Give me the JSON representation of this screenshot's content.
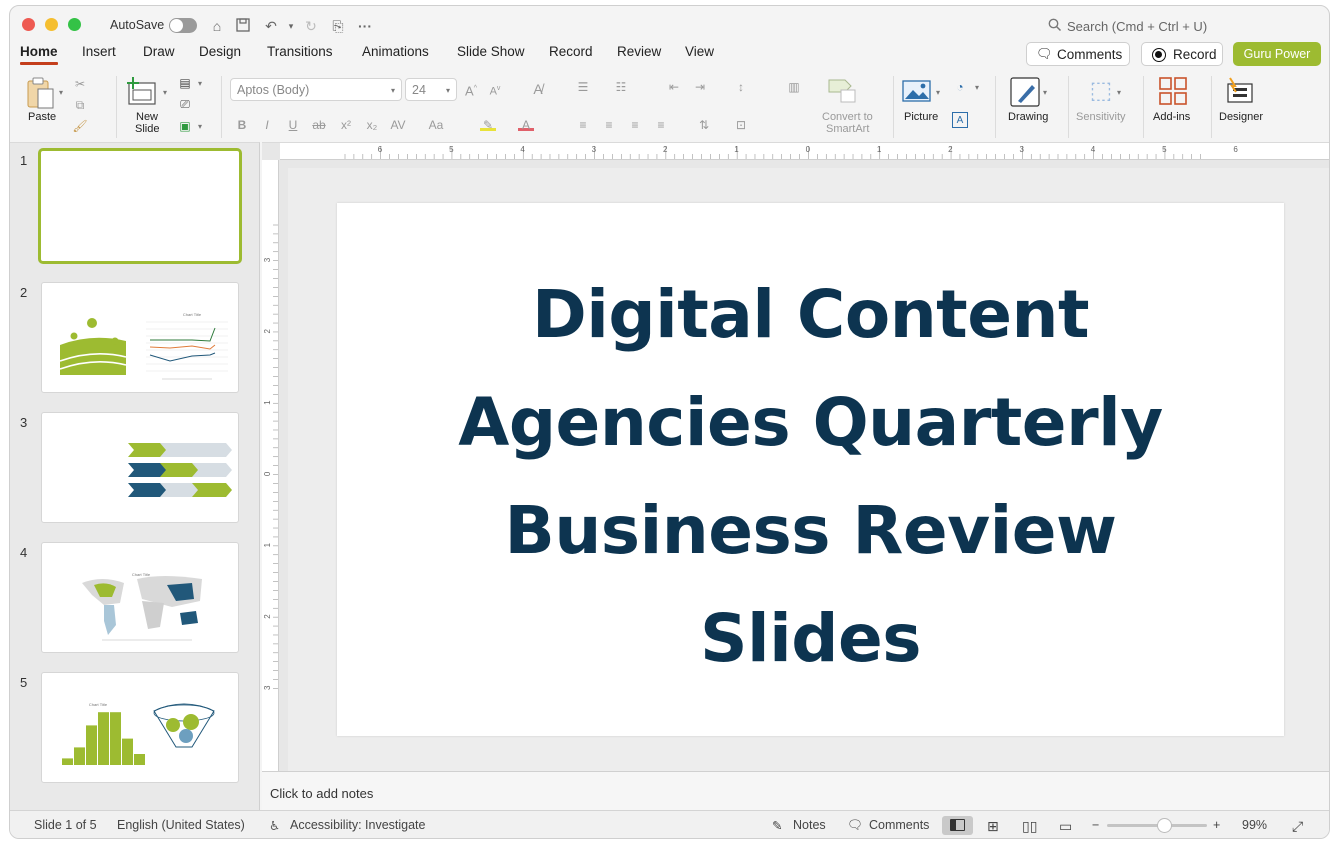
{
  "titlebar": {
    "autosave_label": "AutoSave",
    "search_placeholder": "Search (Cmd + Ctrl + U)"
  },
  "tabs": [
    "Home",
    "Insert",
    "Draw",
    "Design",
    "Transitions",
    "Animations",
    "Slide Show",
    "Record",
    "Review",
    "View"
  ],
  "active_tab": "Home",
  "header_buttons": {
    "comments": "Comments",
    "record": "Record",
    "guru": "Guru Power"
  },
  "ribbon": {
    "paste": "Paste",
    "new_slide_l1": "New",
    "new_slide_l2": "Slide",
    "font_name": "Aptos (Body)",
    "font_size": "24",
    "convert_l1": "Convert to",
    "convert_l2": "SmartArt",
    "picture": "Picture",
    "drawing": "Drawing",
    "sensitivity": "Sensitivity",
    "addins": "Add-ins",
    "designer": "Designer"
  },
  "ruler_labels": [
    "6",
    "5",
    "4",
    "3",
    "2",
    "1",
    "0",
    "1",
    "2",
    "3",
    "4",
    "5",
    "6"
  ],
  "vruler_labels": [
    "3",
    "2",
    "1",
    "0",
    "1",
    "2",
    "3"
  ],
  "slides": [
    {
      "num": "1"
    },
    {
      "num": "2",
      "chart_title": "Chart Title"
    },
    {
      "num": "3"
    },
    {
      "num": "4",
      "chart_title": "Chart Title"
    },
    {
      "num": "5",
      "chart_title": "Chart Title"
    }
  ],
  "slide_title": [
    "Digital Content",
    "Agencies Quarterly",
    "Business Review",
    "Slides"
  ],
  "notes_placeholder": "Click to add notes",
  "statusbar": {
    "slide_info": "Slide 1 of 5",
    "language": "English (United States)",
    "accessibility": "Accessibility: Investigate",
    "notes": "Notes",
    "comments": "Comments",
    "zoom": "99%"
  },
  "zoom_percent": 99,
  "colors": {
    "accent": "#9dbb31",
    "title": "#0d3450",
    "teal": "#21587a"
  }
}
